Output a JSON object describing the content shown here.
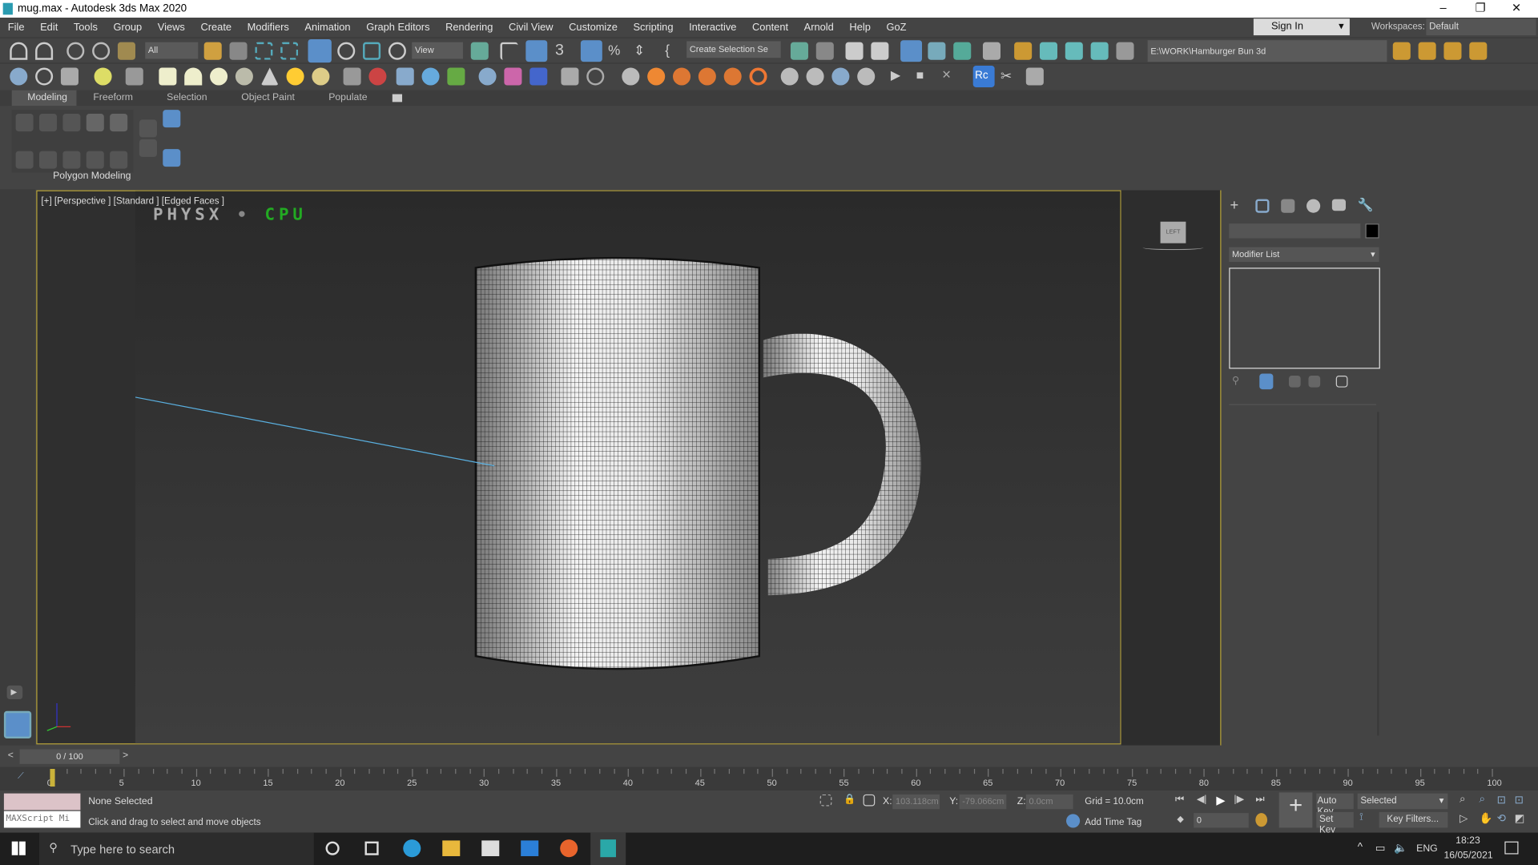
{
  "window": {
    "title": "mug.max - Autodesk 3ds Max 2020",
    "minimize": "–",
    "restore": "❐",
    "close": "✕"
  },
  "menu": [
    "File",
    "Edit",
    "Tools",
    "Group",
    "Views",
    "Create",
    "Modifiers",
    "Animation",
    "Graph Editors",
    "Rendering",
    "Civil View",
    "Customize",
    "Scripting",
    "Interactive",
    "Content",
    "Arnold",
    "Help",
    "GoZ"
  ],
  "account": {
    "sign_in": "Sign In",
    "workspaces_label": "Workspaces:",
    "workspace": "Default"
  },
  "toolbar": {
    "selection_filter": "All",
    "ref_coord": "View",
    "named_sel": "Create Selection Se",
    "project_path": "E:\\WORK\\Hamburger Bun 3d"
  },
  "ribbon": {
    "tabs": [
      "Modeling",
      "Freeform",
      "Selection",
      "Object Paint",
      "Populate"
    ],
    "panel_label": "Polygon Modeling"
  },
  "viewport": {
    "label": "[+] [Perspective ] [Standard ] [Edged Faces ]",
    "physx": "PHYSX",
    "physx_mode": "CPU",
    "navcube": "LEFT"
  },
  "command_panel": {
    "modifier_list": "Modifier List"
  },
  "timeline": {
    "frame": "0 / 100",
    "ticks": [
      "0",
      "5",
      "10",
      "15",
      "20",
      "25",
      "30",
      "35",
      "40",
      "45",
      "50",
      "55",
      "60",
      "65",
      "70",
      "75",
      "80",
      "85",
      "90",
      "95",
      "100"
    ]
  },
  "status": {
    "selection": "None Selected",
    "prompt": "Click and drag to select and move objects",
    "maxscript": "MAXScript Mi",
    "x_label": "X:",
    "x": "103.118cm",
    "y_label": "Y:",
    "y": "-79.066cm",
    "z_label": "Z:",
    "z": "0.0cm",
    "grid": "Grid = 10.0cm",
    "add_time_tag": "Add Time Tag",
    "auto_key": "Auto Key",
    "set_key": "Set Key",
    "key_mode": "Selected",
    "key_filters": "Key Filters...",
    "current_frame": "0"
  },
  "taskbar": {
    "search": "Type here to search",
    "lang": "ENG",
    "time": "18:23",
    "date": "16/05/2021"
  },
  "colors": {
    "accent": "#b8a43a",
    "physx_green": "#22aa22",
    "selection_blue": "#5b8fc9"
  }
}
